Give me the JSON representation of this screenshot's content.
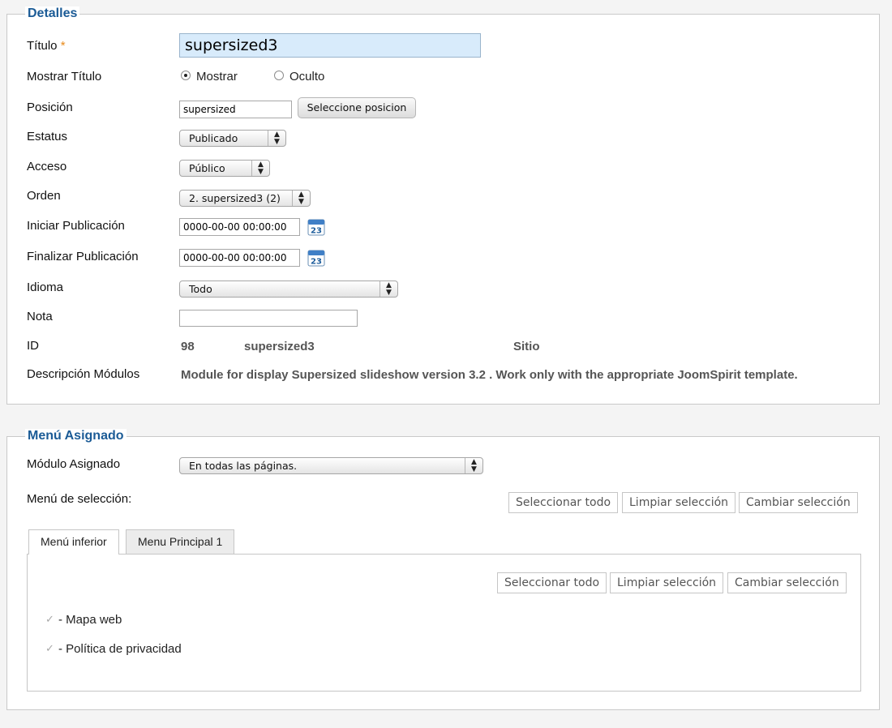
{
  "details": {
    "legend": "Detalles",
    "title_label": "Título",
    "title_required": "*",
    "title_value": "supersized3",
    "show_title_label": "Mostrar Título",
    "show_option": "Mostrar",
    "hide_option": "Oculto",
    "show_title_selected": "Mostrar",
    "position_label": "Posición",
    "position_value": "supersized",
    "position_button": "Seleccione posicion",
    "status_label": "Estatus",
    "status_value": "Publicado",
    "access_label": "Acceso",
    "access_value": "Público",
    "order_label": "Orden",
    "order_value": "2. supersized3 (2)",
    "publish_up_label": "Iniciar Publicación",
    "publish_up_value": "0000-00-00 00:00:00",
    "publish_down_label": "Finalizar Publicación",
    "publish_down_value": "0000-00-00 00:00:00",
    "language_label": "Idioma",
    "language_value": "Todo",
    "note_label": "Nota",
    "note_value": "",
    "id_label": "ID",
    "id_value": "98",
    "id_module_name": "supersized3",
    "id_client": "Sitio",
    "description_label": "Descripción Módulos",
    "description_value": "Module for display Supersized slideshow version 3.2 . Work only with the appropriate JoomSpirit template.",
    "calendar_day": "23",
    "arrow_up": "▲",
    "arrow_down": "▼"
  },
  "menu": {
    "legend": "Menú Asignado",
    "assigned_label": "Módulo Asignado",
    "assigned_value": "En todas las páginas.",
    "selection_label": "Menú de selección:",
    "select_all": "Seleccionar todo",
    "clear_selection": "Limpiar selección",
    "toggle_selection": "Cambiar selección",
    "tabs": [
      {
        "label": "Menú inferior",
        "active": true
      },
      {
        "label": "Menu Principal 1",
        "active": false
      }
    ],
    "items": [
      {
        "label": "- Mapa web",
        "checked": true
      },
      {
        "label": "- Política de privacidad",
        "checked": true
      }
    ],
    "check_glyph": "✓"
  },
  "colors": {
    "legend": "#1b5b96",
    "required_star": "#e88a1a",
    "title_input_bg": "#d8ebfb"
  }
}
